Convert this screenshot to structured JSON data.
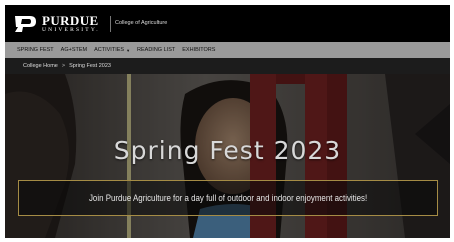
{
  "header": {
    "logo_word": "PURDUE",
    "logo_sub": "UNIVERSITY.",
    "college": "College of Agriculture"
  },
  "nav": {
    "items": [
      {
        "label": "SPRING FEST"
      },
      {
        "label": "AG+STEM"
      },
      {
        "label": "ACTIVITIES",
        "has_dropdown": true
      },
      {
        "label": "READING LIST"
      },
      {
        "label": "EXHIBITORS"
      }
    ]
  },
  "breadcrumb": {
    "home": "College Home",
    "separator": ">",
    "current": "Spring Fest 2023"
  },
  "hero": {
    "title": "Spring Fest 2023",
    "subtitle": "Join Purdue Agriculture for a day full of outdoor and indoor enjoyment activities!"
  },
  "colors": {
    "brand_gold": "#a58c45",
    "nav_bg": "#9a9a9a",
    "header_bg": "#000000"
  }
}
